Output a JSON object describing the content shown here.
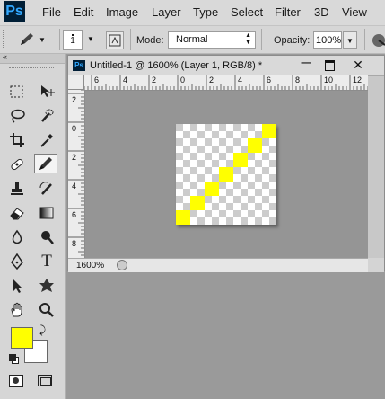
{
  "app": {
    "logo": "Ps"
  },
  "menu": [
    "File",
    "Edit",
    "Image",
    "Layer",
    "Type",
    "Select",
    "Filter",
    "3D",
    "View"
  ],
  "options": {
    "brush_size": "1",
    "mode_label": "Mode:",
    "mode_value": "Normal",
    "opacity_label": "Opacity:",
    "opacity_value": "100%"
  },
  "document": {
    "title": "Untitled-1 @ 1600% (Layer 1, RGB/8) *",
    "zoom": "1600%",
    "ruler_top": [
      "6",
      "4",
      "2",
      "0",
      "2",
      "4",
      "6",
      "8",
      "10",
      "12"
    ],
    "ruler_left": [
      "2",
      "0",
      "2",
      "4",
      "6",
      "8"
    ],
    "pixel_grid": {
      "cols": 7,
      "rows": 7,
      "filled_color": "#ffff00",
      "filled_cells": [
        [
          6,
          0
        ],
        [
          5,
          1
        ],
        [
          4,
          2
        ],
        [
          3,
          3
        ],
        [
          2,
          4
        ],
        [
          1,
          5
        ],
        [
          0,
          6
        ]
      ]
    }
  },
  "colors": {
    "foreground": "#ffff00",
    "background": "#ffffff"
  },
  "tools": {
    "rows": [
      [
        "rect-marquee-icon",
        "move-icon"
      ],
      [
        "lasso-icon",
        "quick-selection-icon"
      ],
      [
        "crop-icon",
        "eyedropper-icon"
      ],
      [
        "healing-brush-icon",
        "pencil-icon"
      ],
      [
        "clone-stamp-icon",
        "history-brush-icon"
      ],
      [
        "eraser-icon",
        "gradient-icon"
      ],
      [
        "blur-icon",
        "dodge-icon"
      ],
      [
        "pen-icon",
        "type-icon"
      ],
      [
        "path-selection-icon",
        "custom-shape-icon"
      ],
      [
        "hand-icon",
        "zoom-icon"
      ]
    ],
    "active": "pencil-icon"
  }
}
